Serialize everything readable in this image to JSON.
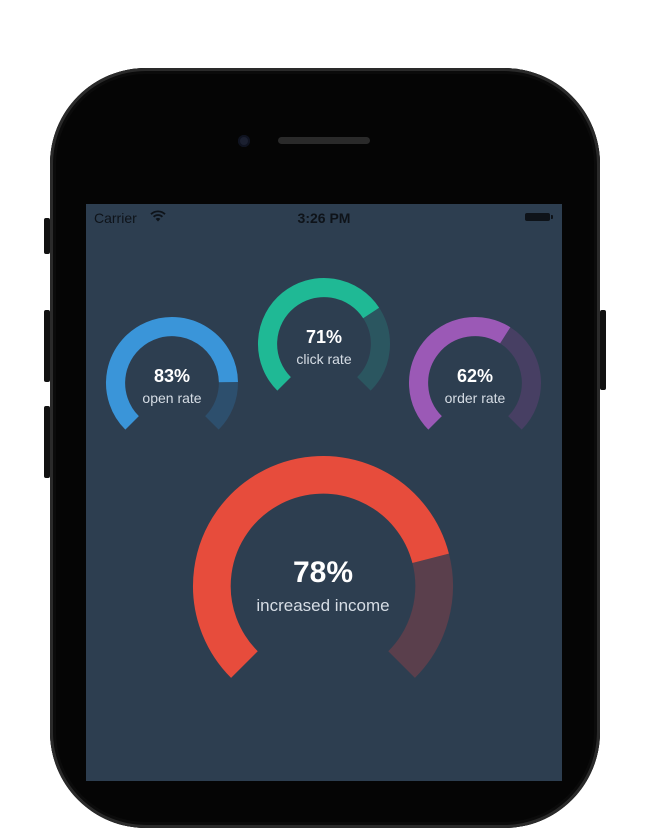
{
  "status_bar": {
    "carrier": "Carrier",
    "time": "3:26 PM",
    "icons": [
      "wifi-icon",
      "battery-icon"
    ]
  },
  "colors": {
    "screen_background": "#2d3e50",
    "track": "#3b4f66"
  },
  "gauges": {
    "open_rate": {
      "value_text": "83%",
      "label": "open rate",
      "value": 0.83,
      "color": "#3a95d9",
      "track": "#2d4f6d"
    },
    "click_rate": {
      "value_text": "71%",
      "label": "click rate",
      "value": 0.71,
      "color": "#1fb995",
      "track": "#2b5660"
    },
    "order_rate": {
      "value_text": "62%",
      "label": "order rate",
      "value": 0.62,
      "color": "#9b59b6",
      "track": "#473f63"
    },
    "income": {
      "value_text": "78%",
      "label": "increased income",
      "value": 0.78,
      "color": "#e74c3c",
      "track": "#5a3f4c"
    }
  }
}
